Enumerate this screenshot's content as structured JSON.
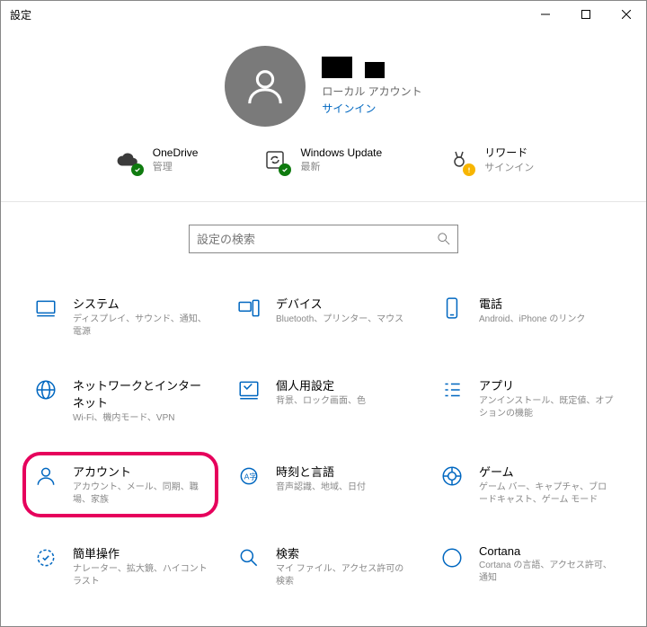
{
  "window": {
    "title": "設定"
  },
  "profile": {
    "account_type": "ローカル アカウント",
    "signin_label": "サインイン"
  },
  "status": [
    {
      "id": "onedrive",
      "title": "OneDrive",
      "sub": "管理",
      "badge": "ok"
    },
    {
      "id": "update",
      "title": "Windows Update",
      "sub": "最新",
      "badge": "ok"
    },
    {
      "id": "rewards",
      "title": "リワード",
      "sub": "サインイン",
      "badge": "warn"
    }
  ],
  "search": {
    "placeholder": "設定の検索"
  },
  "categories": [
    {
      "id": "system",
      "title": "システム",
      "desc": "ディスプレイ、サウンド、通知、電源"
    },
    {
      "id": "devices",
      "title": "デバイス",
      "desc": "Bluetooth、プリンター、マウス"
    },
    {
      "id": "phone",
      "title": "電話",
      "desc": "Android、iPhone のリンク"
    },
    {
      "id": "network",
      "title": "ネットワークとインターネット",
      "desc": "Wi-Fi、機内モード、VPN"
    },
    {
      "id": "personalization",
      "title": "個人用設定",
      "desc": "背景、ロック画面、色"
    },
    {
      "id": "apps",
      "title": "アプリ",
      "desc": "アンインストール、既定値、オプションの機能"
    },
    {
      "id": "accounts",
      "title": "アカウント",
      "desc": "アカウント、メール、同期、職場、家族",
      "highlighted": true
    },
    {
      "id": "time",
      "title": "時刻と言語",
      "desc": "音声認識、地域、日付"
    },
    {
      "id": "gaming",
      "title": "ゲーム",
      "desc": "ゲーム バー、キャプチャ、ブロードキャスト、ゲーム モード"
    },
    {
      "id": "ease",
      "title": "簡単操作",
      "desc": "ナレーター、拡大鏡、ハイコントラスト"
    },
    {
      "id": "search-cat",
      "title": "検索",
      "desc": "マイ ファイル、アクセス許可の検索"
    },
    {
      "id": "cortana",
      "title": "Cortana",
      "desc": "Cortana の言語、アクセス許可、通知"
    }
  ]
}
